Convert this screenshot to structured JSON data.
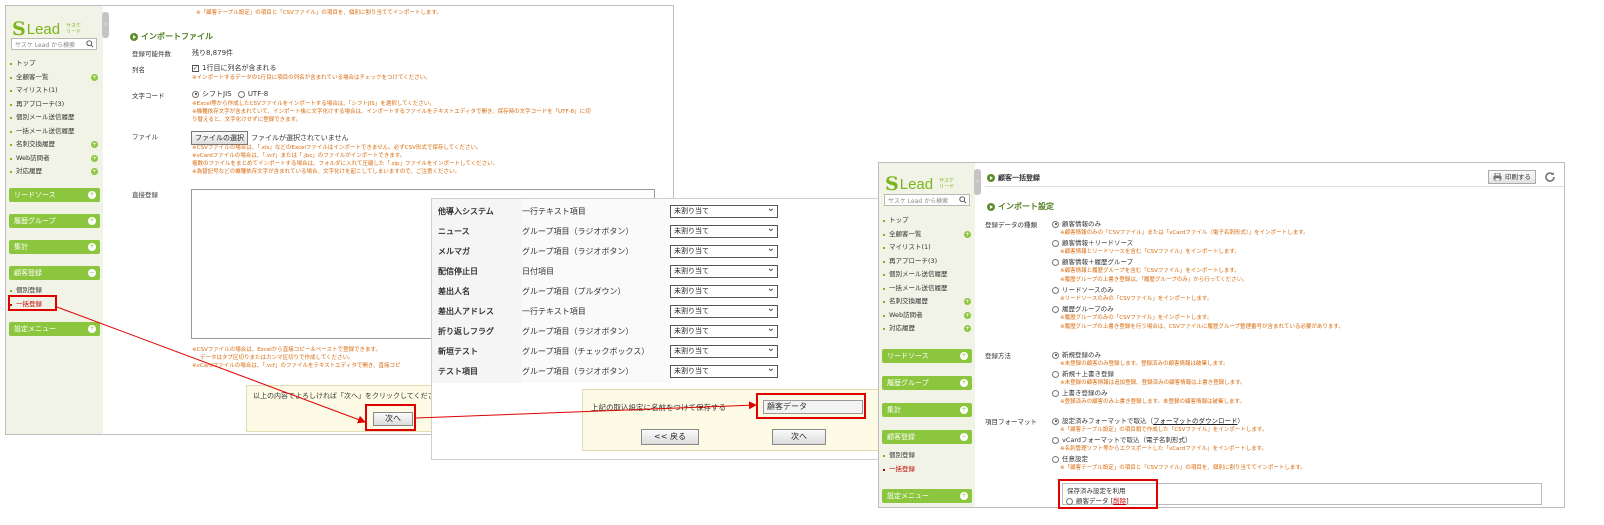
{
  "sidebar": {
    "logo": {
      "mark": "S",
      "text": "Lead",
      "sub": "サスケ リード"
    },
    "search_placeholder": "サスケ Lead から検索",
    "nav": [
      "トップ",
      "全顧客一覧",
      "マイリスト(1)",
      "再アプローチ(3)",
      "個別メール送信履歴",
      "一括メール送信履歴",
      "名刺交換履歴",
      "Web訪問者",
      "対応履歴"
    ],
    "sections": [
      "リードソース",
      "履歴グループ",
      "集計",
      "顧客登録"
    ],
    "customer_items": [
      "個別登録",
      "一括登録"
    ],
    "settings": "設定メニュー"
  },
  "left": {
    "top_note": "※「顧客テーブル設定」の項目と「CSVファイル」の項目を、個別に割り当ててインポートします。",
    "heading": "インポートファイル",
    "rows": {
      "capacity": {
        "label": "登録可能件数",
        "value": "残り8,879件"
      },
      "header": {
        "label": "列名",
        "checkbox": "1行目に列名が含まれる",
        "note": "※インポートするデータの1行目に項目の列名が含まれている場合はチェックをつけてください。"
      },
      "encoding": {
        "label": "文字コード",
        "option1": "シフトJIS",
        "option2": "UTF-8",
        "note1": "※Excel等から作成したCSVファイルをインポートする場合は、「シフトJIS」を選択してください。",
        "note2": "※機種依存文字が含まれていて、インポート後に文字化けする場合は、インポートするファイルをテキストエディタで開き、保存時の文字コードを「UTF-8」に切",
        "note3": "り替えると、文字化けせずに登録できます。"
      },
      "file": {
        "label": "ファイル",
        "button": "ファイルの選択",
        "status": "ファイルが選択されていません",
        "note1": "※CSVファイルの場合は、「.xls」などのExcelファイルはインポートできません。必ずCSV形式で保存してください。",
        "note2": "※vCardファイルの場合は、「.vcf」または「.jbc」のファイルがインポートできます。",
        "note3": "複数のファイルをまとめてインポートする場合は、フォルダに入れて圧縮した「.zip」ファイルをインポートしてください。",
        "note4": "※為替記号などの機種依存文字が含まれている場合、文字化けを起こしてしまいますので、ご注意ください。"
      },
      "direct": {
        "label": "直接登録",
        "note1": "※CSVファイルの場合は、Excelから直接コピー＆ペーストで登録できます。",
        "note2": "データはタブ区切りまたはカンマ区切りで作成してください。",
        "note3": "※vCardファイルの場合は、「.vcf」のファイルをテキストエディタで開き、直接コピ"
      }
    },
    "footer_text": "以上の内容でよろしければ「次へ」をクリックしてくださ",
    "next_button": "次へ"
  },
  "middle": {
    "rows": [
      {
        "name": "他導入システム",
        "type": "一行テキスト項目",
        "select": "未割り当て"
      },
      {
        "name": "ニュース",
        "type": "グループ項目（ラジオボタン）",
        "select": "未割り当て"
      },
      {
        "name": "メルマガ",
        "type": "グループ項目（ラジオボタン）",
        "select": "未割り当て"
      },
      {
        "name": "配信停止日",
        "type": "日付項目",
        "select": "未割り当て"
      },
      {
        "name": "差出人名",
        "type": "グループ項目（プルダウン）",
        "select": "未割り当て"
      },
      {
        "name": "差出人アドレス",
        "type": "一行テキスト項目",
        "select": "未割り当て"
      },
      {
        "name": "折り返しフラグ",
        "type": "グループ項目（ラジオボタン）",
        "select": "未割り当て"
      },
      {
        "name": "新垣テスト",
        "type": "グループ項目（チェックボックス）",
        "select": "未割り当て"
      },
      {
        "name": "テスト項目",
        "type": "グループ項目（ラジオボタン）",
        "select": "未割り当て"
      }
    ],
    "save_label": "上記の取込設定に名前をつけて保存する",
    "save_value": "顧客データ",
    "back_button": "<< 戻る",
    "next_button": "次へ"
  },
  "right": {
    "title": "顧客一括登録",
    "print_button": "印刷する",
    "heading": "インポート設定",
    "type_label": "登録データの種類",
    "type_options": [
      {
        "text": "顧客情報のみ",
        "on": true,
        "notes": [
          "※顧客情報のみの「CSVファイル」または「vCardファイル（電子名刺形式）」をインポートします。"
        ]
      },
      {
        "text": "顧客情報＋リードソース",
        "on": false,
        "notes": [
          "※顧客情報とリードソースを含む「CSVファイル」をインポートします。"
        ]
      },
      {
        "text": "顧客情報＋履歴グループ",
        "on": false,
        "notes": [
          "※顧客情報と履歴グループを含む「CSVファイル」をインポートします。",
          "※履歴グループの上書き登録は、「履歴グループのみ」から行ってください。"
        ]
      },
      {
        "text": "リードソースのみ",
        "on": false,
        "notes": [
          "※リードソースのみの「CSVファイル」をインポートします。"
        ]
      },
      {
        "text": "履歴グループのみ",
        "on": false,
        "notes": [
          "※履歴グループのみの「CSVファイル」をインポートします。",
          "※履歴グループの上書き登録を行う場合は、CSVファイルに履歴グループ整理番号が含まれている必要があります。"
        ]
      }
    ],
    "method_label": "登録方法",
    "method_options": [
      {
        "text": "新規登録のみ",
        "on": true,
        "notes": [
          "※未登録の顧客のみ登録します。登録済みの顧客情報は破棄します。"
        ]
      },
      {
        "text": "新規＋上書き登録",
        "on": false,
        "notes": [
          "※未登録の顧客情報は追加登録、登録済みの顧客情報は上書き登録します。"
        ]
      },
      {
        "text": "上書き登録のみ",
        "on": false,
        "notes": [
          "※登録済みの顧客のみ上書き登録します。未登録の顧客情報は破棄します。"
        ]
      }
    ],
    "format_label": "項目フォーマット",
    "format_options": [
      {
        "text": "設定済みフォーマットで取込（",
        "link": "フォーマットのダウンロード",
        "after": "）",
        "on": true,
        "notes": [
          "※「顧客テーブル設定」の項目順で作成した「CSVファイル」をインポートします。"
        ]
      },
      {
        "text": "vCardフォーマットで取込（電子名刺形式）",
        "on": false,
        "notes": [
          "※名刺管理ソフト等からエクスポートした「vCardファイル」をインポートします。"
        ]
      },
      {
        "text": "任意設定",
        "on": false,
        "notes": [
          "※「顧客テーブル設定」の項目と「CSVファイル」の項目を、個別に割り当ててインポートします。"
        ]
      }
    ],
    "saved_title": "保存済み設定を利用",
    "saved_item": "顧客データ",
    "saved_delete": "削除"
  }
}
